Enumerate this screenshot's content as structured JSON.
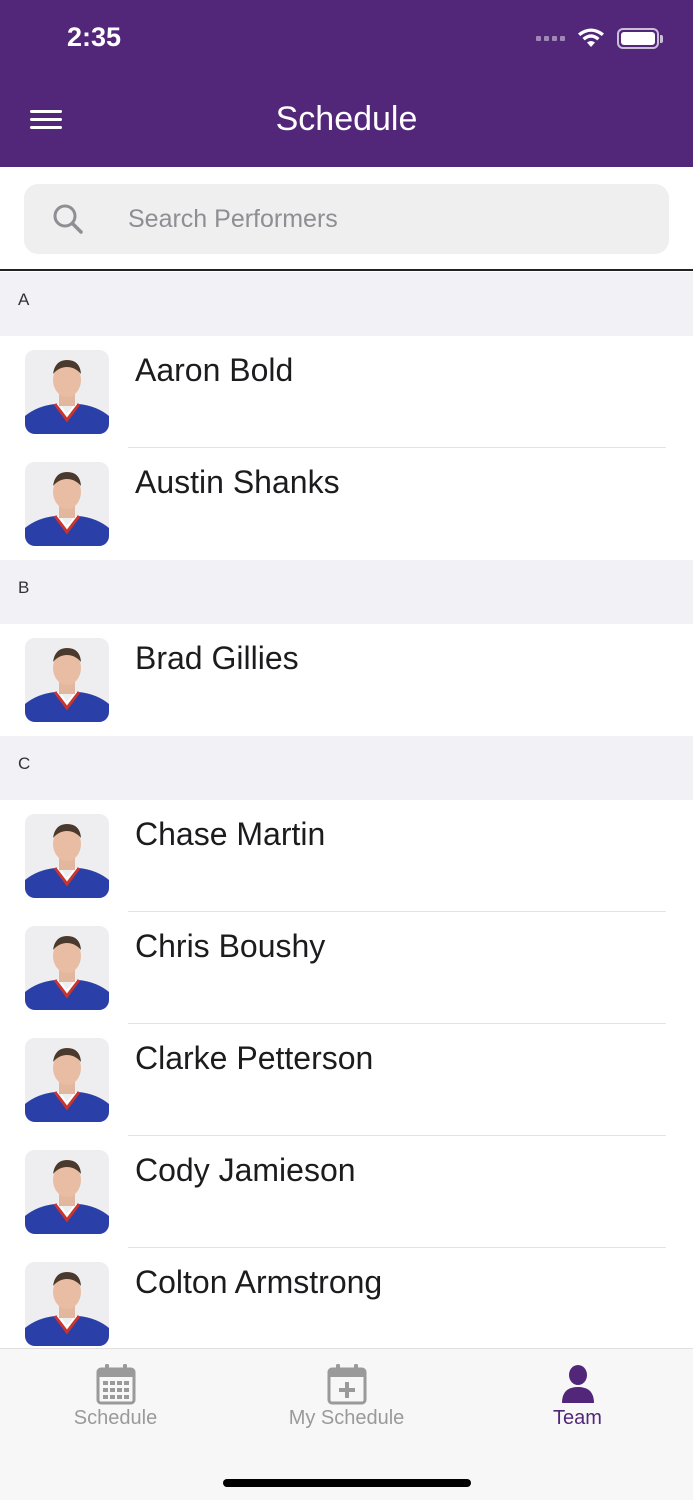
{
  "status_bar": {
    "time": "2:35"
  },
  "header": {
    "title": "Schedule"
  },
  "search": {
    "placeholder": "Search Performers"
  },
  "sections": [
    {
      "letter": "A",
      "performers": [
        "Aaron Bold",
        "Austin Shanks"
      ]
    },
    {
      "letter": "B",
      "performers": [
        "Brad Gillies"
      ]
    },
    {
      "letter": "C",
      "performers": [
        "Chase Martin",
        "Chris Boushy",
        "Clarke Petterson",
        "Cody Jamieson",
        "Colton Armstrong"
      ]
    }
  ],
  "tabs": [
    {
      "label": "Schedule",
      "icon": "calendar-icon",
      "active": false
    },
    {
      "label": "My Schedule",
      "icon": "calendar-add-icon",
      "active": false
    },
    {
      "label": "Team",
      "icon": "person-icon",
      "active": true
    }
  ],
  "colors": {
    "brand": "#52277a",
    "tab_inactive": "#9a9a9a",
    "jersey": "#2a3fa8"
  }
}
